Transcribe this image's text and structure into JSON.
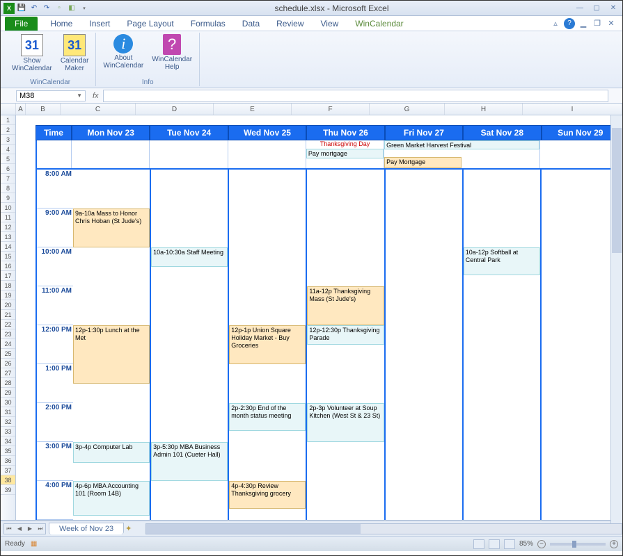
{
  "window": {
    "title": "schedule.xlsx - Microsoft Excel"
  },
  "ribbon": {
    "file": "File",
    "tabs": [
      "Home",
      "Insert",
      "Page Layout",
      "Formulas",
      "Data",
      "Review",
      "View",
      "WinCalendar"
    ],
    "active_tab": "WinCalendar",
    "groups": {
      "wincalendar": {
        "title": "WinCalendar",
        "show_btn": "Show\nWinCalendar",
        "maker_btn": "Calendar\nMaker"
      },
      "info": {
        "title": "Info",
        "about_btn": "About\nWinCalendar",
        "help_btn": "WinCalendar\nHelp"
      }
    }
  },
  "formula": {
    "namebox": "M38",
    "fx": "fx"
  },
  "columns": [
    "A",
    "B",
    "C",
    "D",
    "E",
    "F",
    "G",
    "H",
    "I"
  ],
  "rows": [
    "1",
    "2",
    "3",
    "4",
    "5",
    "6",
    "7",
    "8",
    "9",
    "10",
    "11",
    "12",
    "13",
    "14",
    "15",
    "16",
    "17",
    "18",
    "19",
    "20",
    "21",
    "22",
    "23",
    "24",
    "25",
    "26",
    "27",
    "28",
    "29",
    "30",
    "31",
    "32",
    "33",
    "34",
    "35",
    "36",
    "37",
    "38",
    "39"
  ],
  "selected_row": "38",
  "calendar": {
    "time_header": "Time",
    "days": [
      "Mon Nov 23",
      "Tue Nov 24",
      "Wed Nov 25",
      "Thu Nov 26",
      "Fri Nov 27",
      "Sat Nov 28",
      "Sun Nov 29"
    ],
    "holiday": "Thanksgiving Day",
    "times": [
      "8:00 AM",
      "9:00 AM",
      "10:00 AM",
      "11:00 AM",
      "12:00 PM",
      "1:00 PM",
      "2:00 PM",
      "3:00 PM",
      "4:00 PM"
    ],
    "allday": {
      "thu": "Pay mortgage",
      "fri_sat": "Green Market Harvest Festival",
      "fri": "Pay Mortgage"
    },
    "events": {
      "mon_9a": "9a-10a Mass to Honor Chris Hoban (St Jude's)",
      "tue_10a": "10a-10:30a Staff Meeting",
      "sat_10a": "10a-12p Softball at Central Park",
      "thu_11a": "11a-12p Thanksgiving Mass (St Jude's)",
      "mon_12p": "12p-1:30p Lunch at the Met",
      "wed_12p": "12p-1p Union Square Holiday Market - Buy Groceries",
      "thu_12p": "12p-12:30p Thanksgiving Parade",
      "wed_2p": "2p-2:30p End of the month status meeting",
      "thu_2p": "2p-3p Volunteer at Soup Kitchen (West St & 23 St)",
      "mon_3p": "3p-4p Computer Lab",
      "tue_3p": "3p-5:30p MBA Business Admin 101 (Cueter Hall)",
      "mon_4p": "4p-6p MBA Accounting 101 (Room 14B)",
      "wed_4p": "4p-4:30p Review Thanksgiving grocery"
    }
  },
  "sheet": {
    "tab": "Week of Nov 23"
  },
  "status": {
    "ready": "Ready",
    "zoom": "85%"
  }
}
